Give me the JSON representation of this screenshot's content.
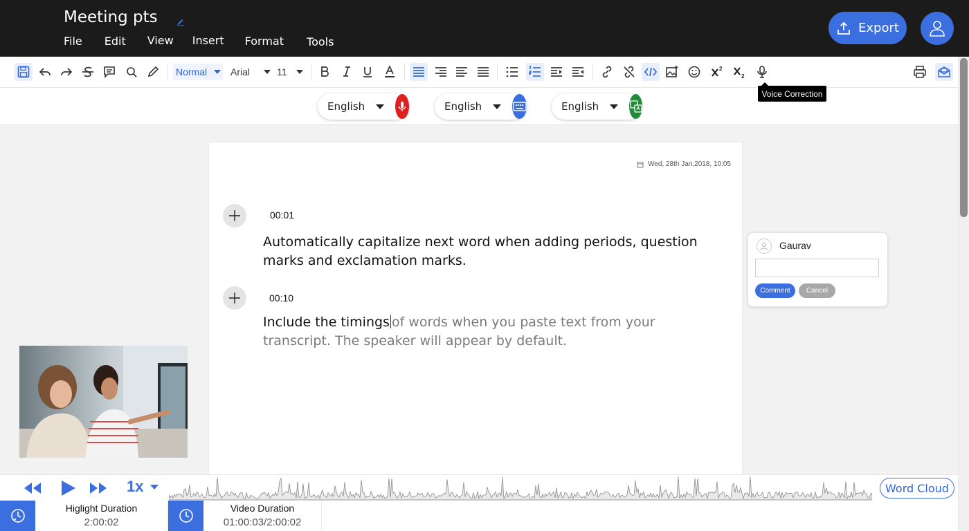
{
  "header": {
    "title": "Meeting pts",
    "menu": [
      "File",
      "Edit",
      "View",
      "Insert",
      "Format",
      "Tools"
    ],
    "export_label": "Export",
    "accent_color": "#3b6fe0"
  },
  "toolbar": {
    "paragraph_style": "Normal",
    "font": "Arial",
    "font_size": "11",
    "tooltip": "Voice Correction"
  },
  "languages": [
    {
      "label": "English",
      "icon": "microphone-icon",
      "color": "#e02020"
    },
    {
      "label": "English",
      "icon": "keyboard-icon",
      "color": "#3b6fe0"
    },
    {
      "label": "English",
      "icon": "translate-icon",
      "color": "#228b3a"
    }
  ],
  "document": {
    "date": "Wed, 28th Jan,2018, 10:05",
    "blocks": [
      {
        "time": "00:01",
        "text": "Automatically capitalize next word when adding periods, question marks and exclamation marks."
      },
      {
        "time": "00:10",
        "text_before": "Include the timings",
        "text_after": "of words when you paste text from your transcript. The speaker will appear by default."
      }
    ]
  },
  "comment": {
    "user": "Gaurav",
    "comment_label": "Comment",
    "cancel_label": "Cancel"
  },
  "player": {
    "speed": "1x",
    "word_cloud_label": "Word Cloud"
  },
  "footer": {
    "highlight_label": "Higlight Duration",
    "highlight_value": "2:00:02",
    "video_label": "Video Duration",
    "video_value": "01:00:03/2:00:02"
  }
}
